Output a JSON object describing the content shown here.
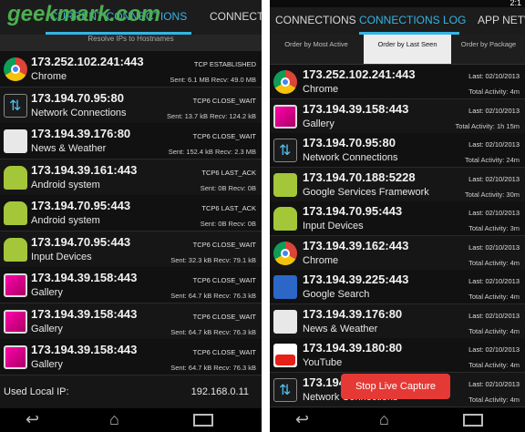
{
  "watermark": "geekmark.com",
  "left": {
    "tabs": [
      "CURRENT CONNECTIONS",
      "CONNECTIO"
    ],
    "resolve": "Resolve IPs to Hostnames",
    "rows": [
      {
        "ip": "173.252.102.241:443",
        "app": "Chrome",
        "state": "TCP ESTABLISHED",
        "stats": "Sent: 6.1 MB Recv: 49.0 MB",
        "icon": "chrome"
      },
      {
        "ip": "173.194.70.95:80",
        "app": "Network Connections",
        "state": "TCP6 CLOSE_WAIT",
        "stats": "Sent: 13.7 kB Recv: 124.2 kB",
        "icon": "netconn"
      },
      {
        "ip": "173.194.39.176:80",
        "app": "News & Weather",
        "state": "TCP6 CLOSE_WAIT",
        "stats": "Sent: 152.4 kB Recv: 2.3 MB",
        "icon": "news"
      },
      {
        "ip": "173.194.39.161:443",
        "app": "Android system",
        "state": "TCP6 LAST_ACK",
        "stats": "Sent: 0B Recv: 0B",
        "icon": "android"
      },
      {
        "ip": "173.194.70.95:443",
        "app": "Android system",
        "state": "TCP6 LAST_ACK",
        "stats": "Sent: 0B Recv: 0B",
        "icon": "android"
      },
      {
        "ip": "173.194.70.95:443",
        "app": "Input Devices",
        "state": "TCP6 CLOSE_WAIT",
        "stats": "Sent: 32.3 kB Recv: 79.1 kB",
        "icon": "android"
      },
      {
        "ip": "173.194.39.158:443",
        "app": "Gallery",
        "state": "TCP6 CLOSE_WAIT",
        "stats": "Sent: 64.7 kB Recv: 76.3 kB",
        "icon": "gallery"
      },
      {
        "ip": "173.194.39.158:443",
        "app": "Gallery",
        "state": "TCP6 CLOSE_WAIT",
        "stats": "Sent: 64.7 kB Recv: 76.3 kB",
        "icon": "gallery"
      },
      {
        "ip": "173.194.39.158:443",
        "app": "Gallery",
        "state": "TCP6 CLOSE_WAIT",
        "stats": "Sent: 64.7 kB Recv: 76.3 kB",
        "icon": "gallery"
      }
    ],
    "footer_label": "Used Local IP:",
    "footer_ip": "192.168.0.11"
  },
  "right": {
    "tabs": [
      "CONNECTIONS",
      "CONNECTIONS LOG",
      "APP NETW"
    ],
    "sort": [
      "Order by Most Active",
      "Order by Last Seen",
      "Order by Package"
    ],
    "rows": [
      {
        "ip": "173.252.102.241:443",
        "app": "Chrome",
        "last": "Last: 02/10/2013",
        "activity": "Total Activity: 4m",
        "icon": "chrome"
      },
      {
        "ip": "173.194.39.158:443",
        "app": "Gallery",
        "last": "Last: 02/10/2013",
        "activity": "Total Activity: 1h 15m",
        "icon": "gallery"
      },
      {
        "ip": "173.194.70.95:80",
        "app": "Network Connections",
        "last": "Last: 02/10/2013",
        "activity": "Total Activity: 24m",
        "icon": "netconn"
      },
      {
        "ip": "173.194.70.188:5228",
        "app": "Google Services Framework",
        "last": "Last: 02/10/2013",
        "activity": "Total Activity: 30m",
        "icon": "gsf"
      },
      {
        "ip": "173.194.70.95:443",
        "app": "Input Devices",
        "last": "Last: 02/10/2013",
        "activity": "Total Activity: 3m",
        "icon": "android"
      },
      {
        "ip": "173.194.39.162:443",
        "app": "Chrome",
        "last": "Last: 02/10/2013",
        "activity": "Total Activity: 4m",
        "icon": "chrome"
      },
      {
        "ip": "173.194.39.225:443",
        "app": "Google Search",
        "last": "Last: 02/10/2013",
        "activity": "Total Activity: 4m",
        "icon": "gsearch"
      },
      {
        "ip": "173.194.39.176:80",
        "app": "News & Weather",
        "last": "Last: 02/10/2013",
        "activity": "Total Activity: 4m",
        "icon": "news"
      },
      {
        "ip": "173.194.39.180:80",
        "app": "YouTube",
        "last": "Last: 02/10/2013",
        "activity": "Total Activity: 4m",
        "icon": "youtube"
      },
      {
        "ip": "173.194.70.95:443",
        "app": "Network Connections",
        "last": "Last: 02/10/2013",
        "activity": "Total Activity: 4m",
        "icon": "netconn"
      }
    ],
    "live_capture": "Stop Live Capture",
    "status_time": "2:1"
  }
}
